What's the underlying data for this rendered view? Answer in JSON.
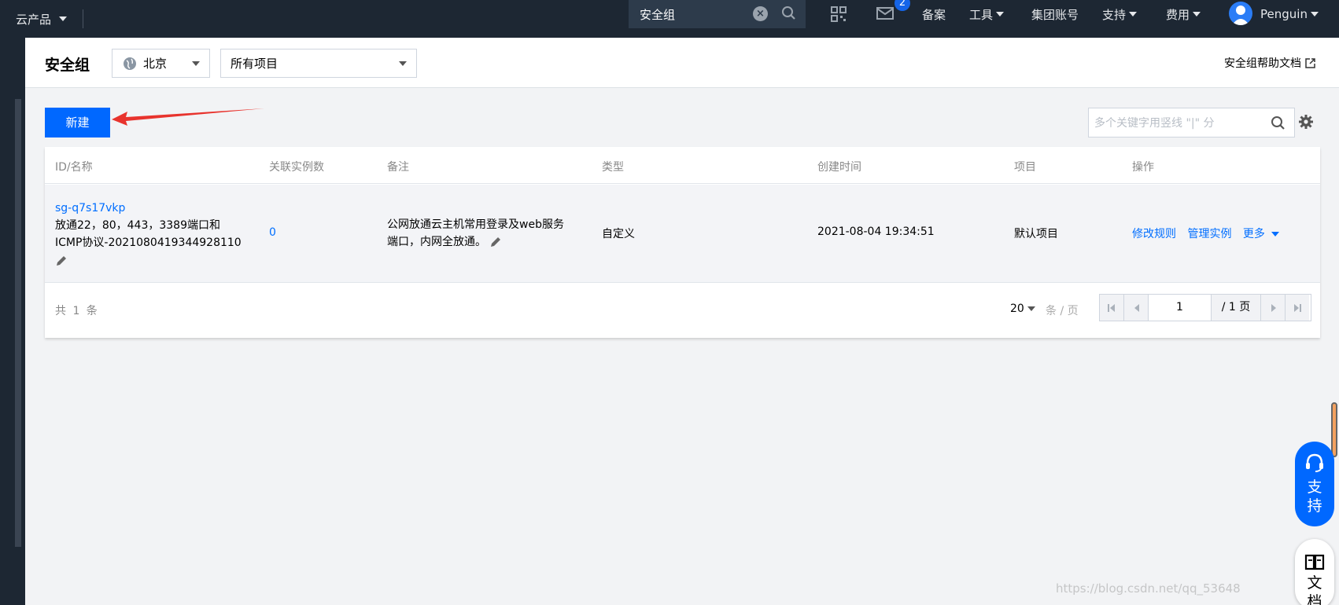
{
  "topbar": {
    "products_label": "云产品",
    "search_value": "安全组",
    "mail_badge": "2",
    "nav_items": [
      "备案",
      "工具",
      "集团账号",
      "支持",
      "费用"
    ],
    "user": "Penguin"
  },
  "header": {
    "title": "安全组",
    "region": "北京",
    "project": "所有项目",
    "help_link": "安全组帮助文档"
  },
  "toolbar": {
    "new_label": "新建",
    "search_placeholder": "多个关键字用竖线 \"|\" 分"
  },
  "table": {
    "columns": [
      "ID/名称",
      "关联实例数",
      "备注",
      "类型",
      "创建时间",
      "项目",
      "操作"
    ],
    "rows": [
      {
        "id": "sg-q7s17vkp",
        "name_line1": "放通22，80，443，3389端口和",
        "name_line2": "ICMP协议-2021080419344928110",
        "instances": "0",
        "remark_line1": "公网放通云主机常用登录及web服务",
        "remark_line2": "端口，内网全放通。",
        "type": "自定义",
        "created": "2021-08-04 19:34:51",
        "project": "默认项目",
        "actions": [
          "修改规则",
          "管理实例",
          "更多"
        ]
      }
    ],
    "total": "共 1 条",
    "page_size": "20",
    "per_page_label": "条 / 页",
    "page": "1",
    "page_total": "/ 1 页"
  },
  "floating": {
    "support": "支\n持",
    "support_1": "支",
    "support_2": "持",
    "docs_1": "文",
    "docs_2": "档"
  },
  "watermark": "https://blog.csdn.net/qq_53648",
  "colors": {
    "primary": "#0068ff",
    "topbar": "#1d2733",
    "link": "#006eff",
    "annotation_arrow": "#e8332d"
  }
}
